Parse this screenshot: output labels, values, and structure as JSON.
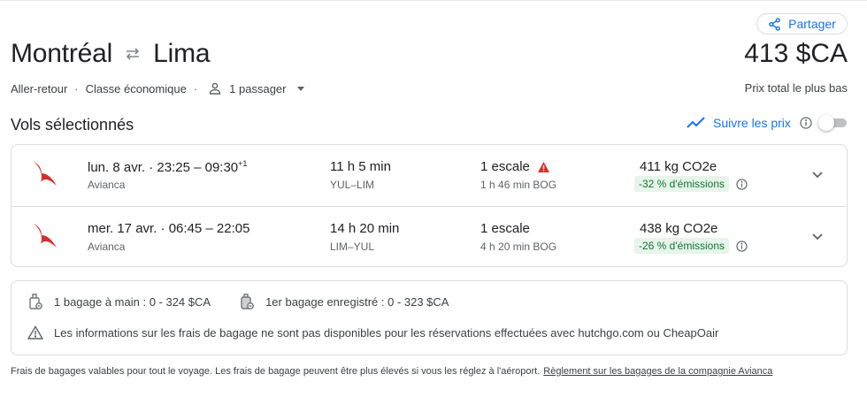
{
  "header": {
    "share_label": "Partager",
    "origin": "Montréal",
    "destination": "Lima",
    "price": "413 $CA",
    "price_label": "Prix total le plus bas",
    "trip_type": "Aller-retour",
    "cabin": "Classe économique",
    "passengers": "1 passager"
  },
  "selected": {
    "title": "Vols sélectionnés",
    "track_label": "Suivre les prix",
    "track_enabled": false
  },
  "flights": [
    {
      "date": "lun. 8 avr.",
      "times": "23:25 – 09:30",
      "day_offset": "+1",
      "airline": "Avianca",
      "duration": "11 h 5 min",
      "route": "YUL–LIM",
      "stops": "1 escale",
      "stop_warning": true,
      "layover": "1 h 46 min BOG",
      "co2": "411 kg CO2e",
      "emissions": "-32 % d'émissions"
    },
    {
      "date": "mer. 17 avr.",
      "times": "06:45 – 22:05",
      "day_offset": "",
      "airline": "Avianca",
      "duration": "14 h 20 min",
      "route": "LIM–YUL",
      "stops": "1 escale",
      "stop_warning": false,
      "layover": "4 h 20 min BOG",
      "co2": "438 kg CO2e",
      "emissions": "-26 % d'émissions"
    }
  ],
  "baggage": {
    "carry_on": "1 bagage à main : 0 - 324 $CA",
    "checked": "1er bagage enregistré : 0 - 323 $CA",
    "notice": "Les informations sur les frais de bagage ne sont pas disponibles pour les réservations effectuées avec hutchgo.com ou CheapOair"
  },
  "footer": {
    "text": "Frais de bagages valables pour tout le voyage. Les frais de bagage peuvent être plus élevés si vous les réglez à l'aéroport.",
    "link": "Règlement sur les bagages de la compagnie Avianca"
  },
  "colors": {
    "accent": "#1a73e8",
    "airline_red": "#d32f2f",
    "emissions_bg": "#e6f4ea",
    "emissions_text": "#137333",
    "warning": "#d93025"
  },
  "icons": [
    "share-icon",
    "swap-arrows-icon",
    "person-icon",
    "trend-icon",
    "info-icon",
    "airline-logo",
    "warning-icon",
    "chevron-down-icon",
    "carry-on-bag-icon",
    "checked-bag-icon"
  ]
}
